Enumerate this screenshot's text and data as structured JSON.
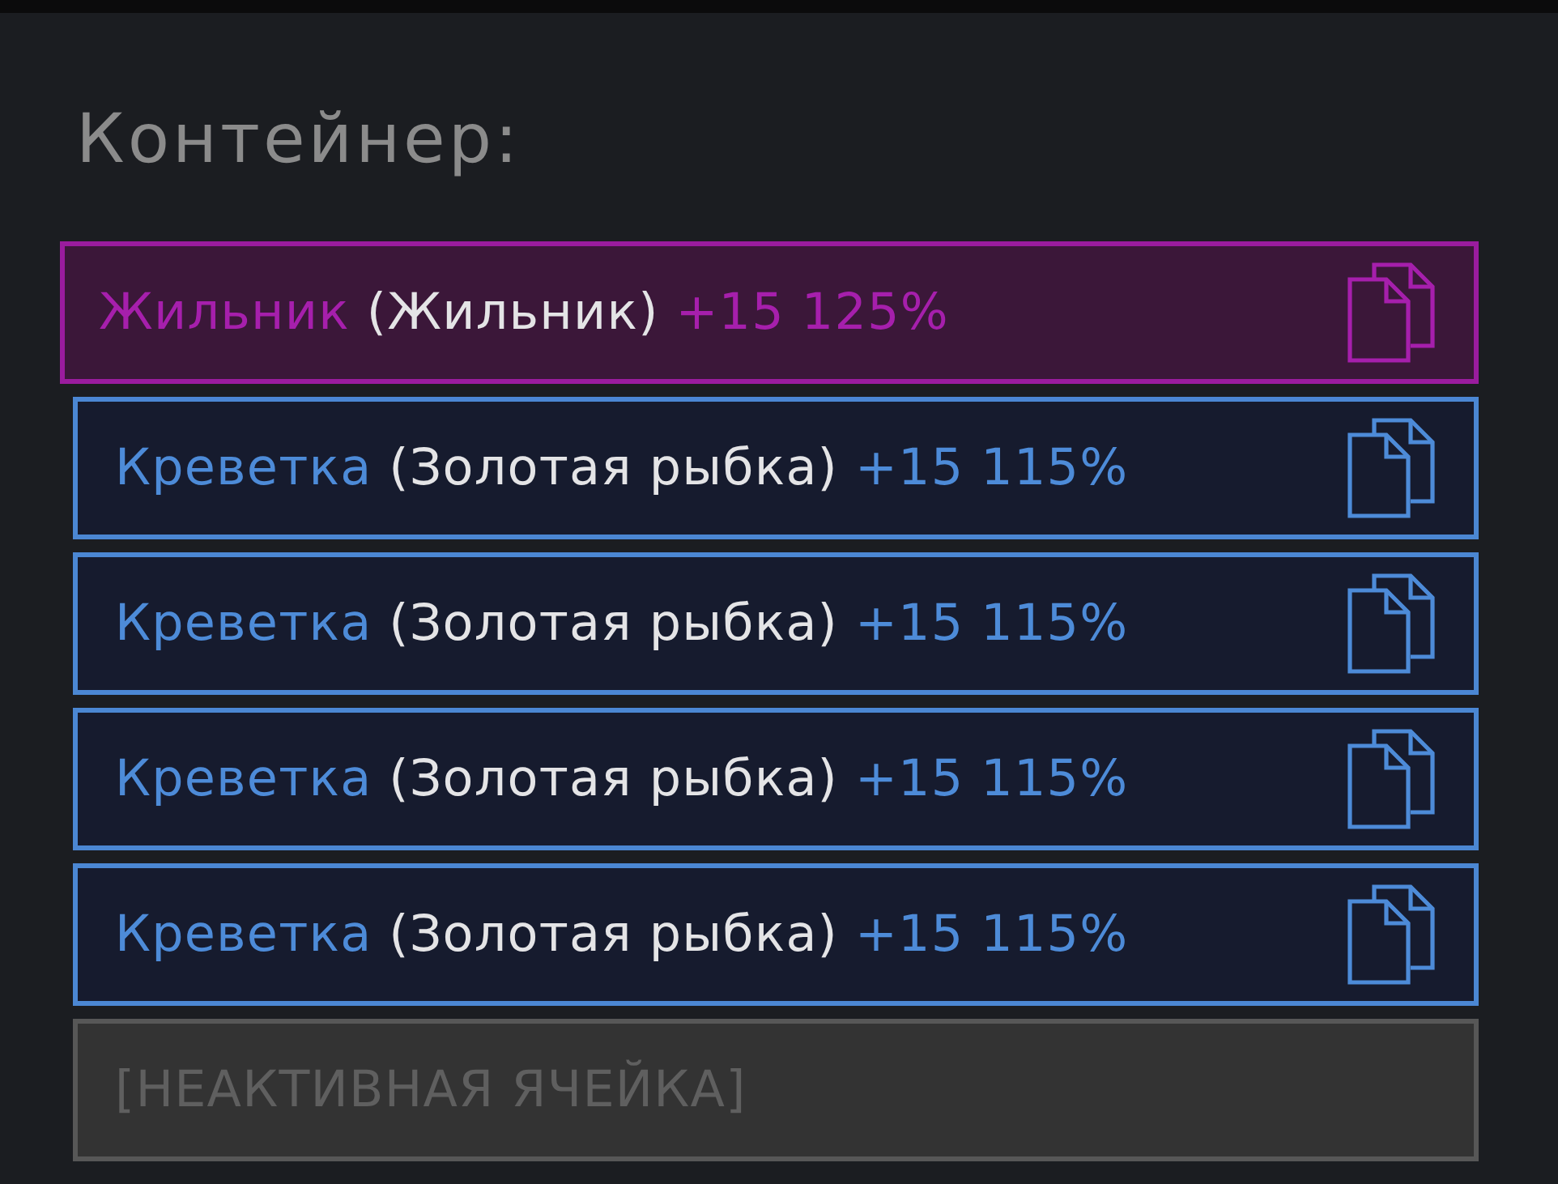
{
  "panel": {
    "title": "Контейнер:"
  },
  "slots": [
    {
      "kind": "item",
      "selected": true,
      "name": "Жильник",
      "origin": "(Жильник)",
      "bonus": "+15 125%"
    },
    {
      "kind": "item",
      "selected": false,
      "name": "Креветка",
      "origin": "(Золотая рыбка)",
      "bonus": "+15 115%"
    },
    {
      "kind": "item",
      "selected": false,
      "name": "Креветка",
      "origin": "(Золотая рыбка)",
      "bonus": "+15 115%"
    },
    {
      "kind": "item",
      "selected": false,
      "name": "Креветка",
      "origin": "(Золотая рыбка)",
      "bonus": "+15 115%"
    },
    {
      "kind": "item",
      "selected": false,
      "name": "Креветка",
      "origin": "(Золотая рыбка)",
      "bonus": "+15 115%"
    },
    {
      "kind": "empty",
      "label": "[НЕАКТИВНАЯ ЯЧЕЙКА]"
    }
  ]
}
